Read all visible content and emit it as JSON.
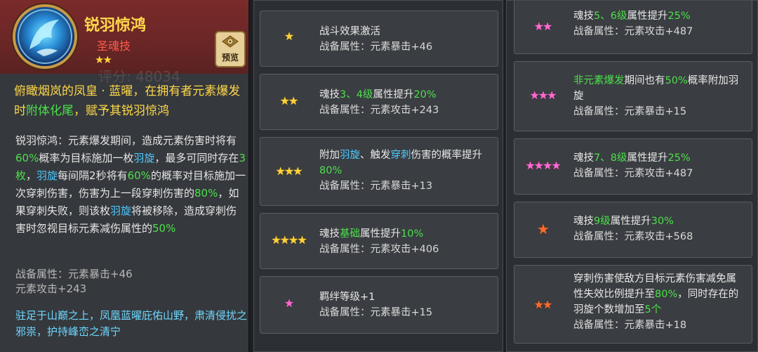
{
  "skill": {
    "name": "锐羽惊鸿",
    "type": "圣魂技",
    "stars": "★★",
    "score_bg": "评分: 48034",
    "preview_label": "预览",
    "lore_parts": [
      "俯瞰烟岚的凤皇 · 蓝曜，在拥有者",
      "元素爆发时",
      "附体化尾",
      "，赋予其锐羽惊鸿"
    ],
    "desc": {
      "p1": "锐羽惊鸿：元素爆发期间，造成元素伤害时将有",
      "v1": "60%",
      "p2": "概率为目标施加一枚",
      "k1": "羽旋",
      "p3": "，最多可同时存在",
      "v2": "3枚",
      "p4": "，",
      "k2": "羽旋",
      "p5": "每间隔2秒将有",
      "v3": "60%",
      "p6": "的概率对目标施加一次穿刺伤害，伤害为上一段穿刺伤害的",
      "v4": "80%",
      "p7": "，如果穿刺失败，则该枚",
      "k3": "羽旋",
      "p8": "将被移除，造成穿刺伤害时忽视目标元素减伤属性的",
      "v5": "50%"
    },
    "stats": [
      "战备属性：元素暴击+46",
      "元素攻击+243"
    ],
    "flavor": "驻足于山巅之上，凤凰蓝曜庇佑山野，肃清侵扰之邪祟，护持峰峦之清宁"
  },
  "mid_cards": [
    {
      "stars": "★",
      "star_color": "gold",
      "line1": "战斗效果激活",
      "stat": "战备属性：元素暴击+46"
    },
    {
      "stars": "★★",
      "star_color": "gold",
      "line1_pre": "魂技",
      "line1_hl": "3、4级",
      "line1_mid": "属性提升",
      "line1_hl2": "20%",
      "stat": "战备属性：元素攻击+243"
    },
    {
      "stars": "★★★",
      "star_color": "gold",
      "line1_pre": "附加",
      "line1_hl": "羽旋",
      "line1_mid": "、触发",
      "line1_hl2": "穿刺",
      "line1_post": "伤害的概率提升",
      "line1_hl3": "80%",
      "stat": "战备属性：元素暴击+13"
    },
    {
      "stars": "★★★★",
      "star_color": "gold",
      "line1_pre": "魂技",
      "line1_hl": "基础",
      "line1_mid": "属性提升",
      "line1_hl2": "10%",
      "stat": "战备属性：元素攻击+406"
    },
    {
      "stars": "★",
      "star_color": "pink",
      "line1": "羁绊等级+1",
      "stat": "战备属性：元素暴击+15"
    }
  ],
  "right_cards": [
    {
      "stars": "★★",
      "star_color": "pink",
      "line1_pre": "魂技",
      "line1_hl": "5、6级",
      "line1_mid": "属性提升",
      "line1_hl2": "25%",
      "stat": "战备属性：元素攻击+487"
    },
    {
      "stars": "★★★",
      "star_color": "pink",
      "line1_hl": "非元素爆发",
      "line1_mid": "期间也有",
      "line1_hl2": "50%",
      "line1_post": "概率附加羽旋",
      "stat": "战备属性：元素暴击+15"
    },
    {
      "stars": "★★★★",
      "star_color": "pink",
      "line1_pre": "魂技",
      "line1_hl": "7、8级",
      "line1_mid": "属性提升",
      "line1_hl2": "25%",
      "stat": "战备属性：元素攻击+487"
    },
    {
      "stars": "★",
      "star_color": "orange",
      "line1_pre": "魂技",
      "line1_hl": "9级",
      "line1_mid": "属性提升",
      "line1_hl2": "30%",
      "stat": "战备属性：元素攻击+568"
    },
    {
      "stars": "★★",
      "star_color": "orange",
      "line1_pre": "穿刺伤害使敌方目标元素伤害减免属性失效比例提升至",
      "line1_hl": "80%",
      "line1_mid": "，同时存在的羽旋个数增加至",
      "line1_hl2": "5个",
      "stat": "战备属性：元素暴击+18"
    }
  ]
}
